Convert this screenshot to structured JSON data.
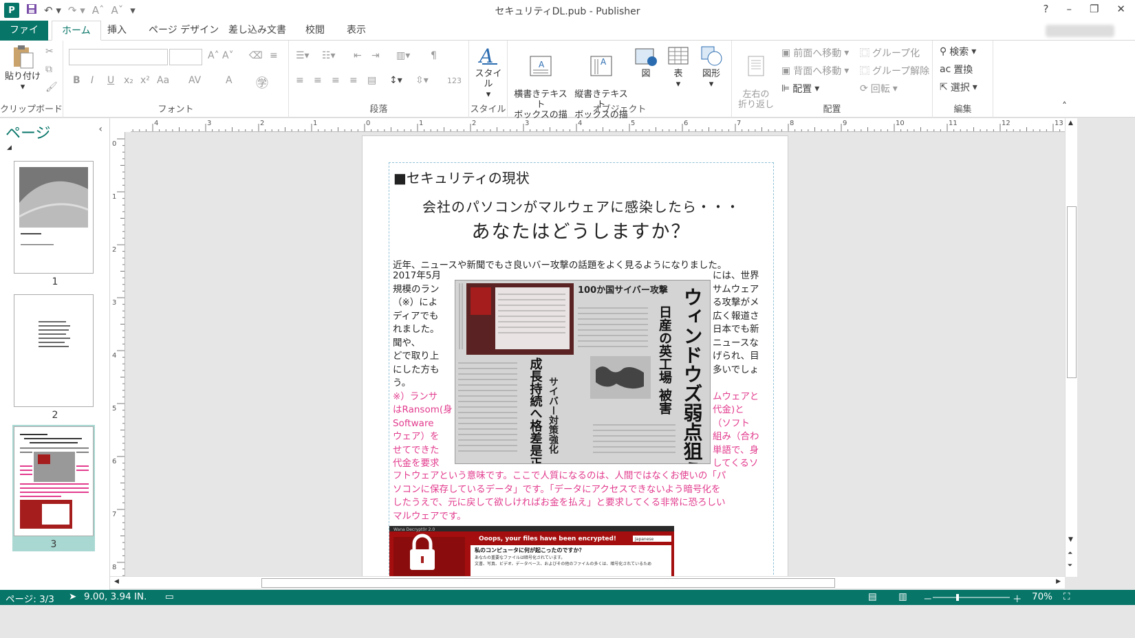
{
  "titlebar": {
    "title": "セキュリティDL.pub - Publisher",
    "app_icon": "P",
    "help": "?"
  },
  "tabs": [
    {
      "label": "ファイル"
    },
    {
      "label": "ホーム"
    },
    {
      "label": "挿入"
    },
    {
      "label": "ページ デザイン"
    },
    {
      "label": "差し込み文書"
    },
    {
      "label": "校閲"
    },
    {
      "label": "表示"
    }
  ],
  "ribbon": {
    "clipboard": {
      "paste": "貼り付け",
      "label": "クリップボード"
    },
    "font": {
      "label": "フォント",
      "bold": "B",
      "italic": "I",
      "underline": "U",
      "subscript": "x₂",
      "superscript": "x²",
      "case": "Aa",
      "spacing": "AV",
      "color": "A"
    },
    "paragraph": {
      "label": "段落",
      "number": "123"
    },
    "styles": {
      "button": "スタイル",
      "label": "スタイル"
    },
    "objects": {
      "h_textbox": "横書きテキスト\nボックスの描画",
      "v_textbox": "縦書きテキスト\nボックスの描画",
      "picture": "図",
      "table": "表",
      "shapes": "図形",
      "label": "オブジェクト"
    },
    "arrange": {
      "wrap": "左右の\n折り返し",
      "bring_forward": "前面へ移動",
      "send_backward": "背面へ移動",
      "align": "配置",
      "group": "グループ化",
      "ungroup": "グループ解除",
      "rotate": "回転",
      "label": "配置"
    },
    "editing": {
      "find": "検索",
      "replace": "置換",
      "select": "選択",
      "label": "編集"
    }
  },
  "pages_pane": {
    "title": "ページ",
    "pages": [
      {
        "number": "1"
      },
      {
        "number": "2"
      },
      {
        "number": "3"
      }
    ]
  },
  "document": {
    "heading": "■セキュリティの現状",
    "subtitle1": "会社のパソコンがマルウェアに感染したら・・・",
    "subtitle2": "あなたはどうしますか？",
    "intro": "近年、ニュースや新聞でもさ良いバー攻撃の話題をよく見るようになりました。",
    "left_col": [
      "2017年5月",
      "規模のラン",
      "（※）によ",
      "ディアでも",
      "れました。",
      "聞や、",
      "どで取り上",
      "にした方も",
      "う。"
    ],
    "right_col": [
      "には、世界",
      "サムウェア",
      "る攻撃がメ",
      "広く報道さ",
      "日本でも新",
      "ニュースな",
      "げられ、目",
      "多いでしょ"
    ],
    "left_col_pink": [
      "※）ランサ",
      "はRansom(身",
      "Software",
      "ウェア）を",
      "せてできた",
      "代金を要求"
    ],
    "right_col_pink": [
      "ムウェアと",
      "代金)と",
      "（ソフト",
      "組み（合わ",
      "単語で、身",
      "してくるソ"
    ],
    "tail": [
      "フトウェアという意味です。ここで人質になるのは、人間ではなくお使いの「パ",
      "ソコンに保存しているデータ」です。「データにアクセスできないよう暗号化を",
      "したうえで、元に戻して欲しければお金を払え」と要求してくる非常に恐ろしい",
      "マルウェアです。"
    ],
    "newspaper": {
      "headline_top": "100か国サイバー攻撃",
      "headline_big": "ウィンドウズ弱点狙う",
      "headline_2": "日産の英工場 被害",
      "headline_3": "成長持続へ格差是正",
      "headline_4": "サイバー対策強化"
    },
    "wannacry": {
      "window_title": "Wana Decrypt0r 2.0",
      "banner": "Ooops, your files have been encrypted!",
      "language": "Japanese",
      "question": "私のコンピュータに何が起こったのですか？",
      "line1": "あなたの重要なファイルは暗号化されています。",
      "line2": "文書、写真、ビデオ、データベース、およびその他のファイルの多くは、暗号化されているため"
    }
  },
  "statusbar": {
    "page": "ページ: 3/3",
    "position": "9.00, 3.94 IN.",
    "zoom": "70%"
  },
  "colors": {
    "accent": "#077568",
    "pink": "#e23b8d"
  }
}
